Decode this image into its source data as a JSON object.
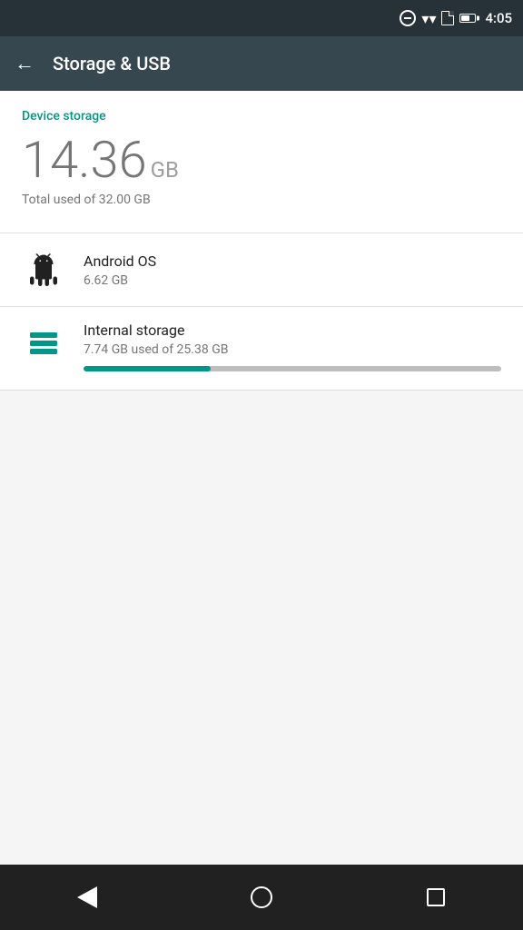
{
  "statusBar": {
    "time": "4:05",
    "icons": [
      "do-not-disturb",
      "wifi",
      "sim",
      "battery"
    ]
  },
  "appBar": {
    "title": "Storage & USB",
    "backLabel": "Back"
  },
  "deviceStorage": {
    "sectionLabel": "Device storage",
    "usedAmount": "14.36",
    "usedUnit": "GB",
    "totalText": "Total used of 32.00 GB"
  },
  "listItems": [
    {
      "id": "android-os",
      "title": "Android OS",
      "subtitle": "6.62 GB",
      "iconType": "android"
    }
  ],
  "internalStorage": {
    "title": "Internal storage",
    "subtitle": "7.74 GB used of 25.38 GB",
    "progressPercent": 30.5,
    "iconType": "storage"
  },
  "navBar": {
    "back": "Back",
    "home": "Home",
    "recents": "Recents"
  }
}
